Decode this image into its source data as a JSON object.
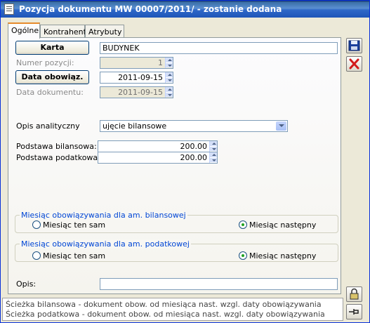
{
  "window": {
    "title": "Pozycja dokumentu MW  00007/2011/ - zostanie dodana"
  },
  "tabs": [
    {
      "label": "Ogólne"
    },
    {
      "label": "Kontrahent"
    },
    {
      "label": "Atrybuty"
    }
  ],
  "form": {
    "karta_button": "Karta",
    "karta_value": "BUDYNEK",
    "numer_label": "Numer pozycji:",
    "numer_value": "1",
    "data_obow_button": "Data obowiąz.",
    "data_obow_value": "2011-09-15",
    "data_dok_label": "Data dokumentu:",
    "data_dok_value": "2011-09-15",
    "opis_analityczny_label": "Opis analityczny",
    "opis_analityczny_value": "ujęcie bilansowe",
    "podstawa_bil_label": "Podstawa bilansowa:",
    "podstawa_bil_value": "200.00",
    "podstawa_pod_label": "Podstawa podatkowa:",
    "podstawa_pod_value": "200.00",
    "group_bil": {
      "legend": "Miesiąc obowiązywania dla am. bilansowej",
      "option1": "Miesiąc ten sam",
      "option2": "Miesiąc następny",
      "selected": "option2"
    },
    "group_pod": {
      "legend": "Miesiąc obowiązywania dla am. podatkowej",
      "option1": "Miesiąc ten sam",
      "option2": "Miesiąc następny",
      "selected": "option2"
    },
    "opis_label": "Opis:",
    "opis_value": ""
  },
  "status": {
    "line1": "Ścieżka bilansowa - dokument obow. od miesiąca nast. wzgl. daty obowiązywania",
    "line2": "Ścieżka podatkowa - dokument obow. od miesiąca nast. wzgl. daty obowiązywania"
  },
  "icons": {
    "save": "save-icon",
    "close": "close-icon",
    "lock": "lock-icon",
    "pin": "pin-icon"
  }
}
